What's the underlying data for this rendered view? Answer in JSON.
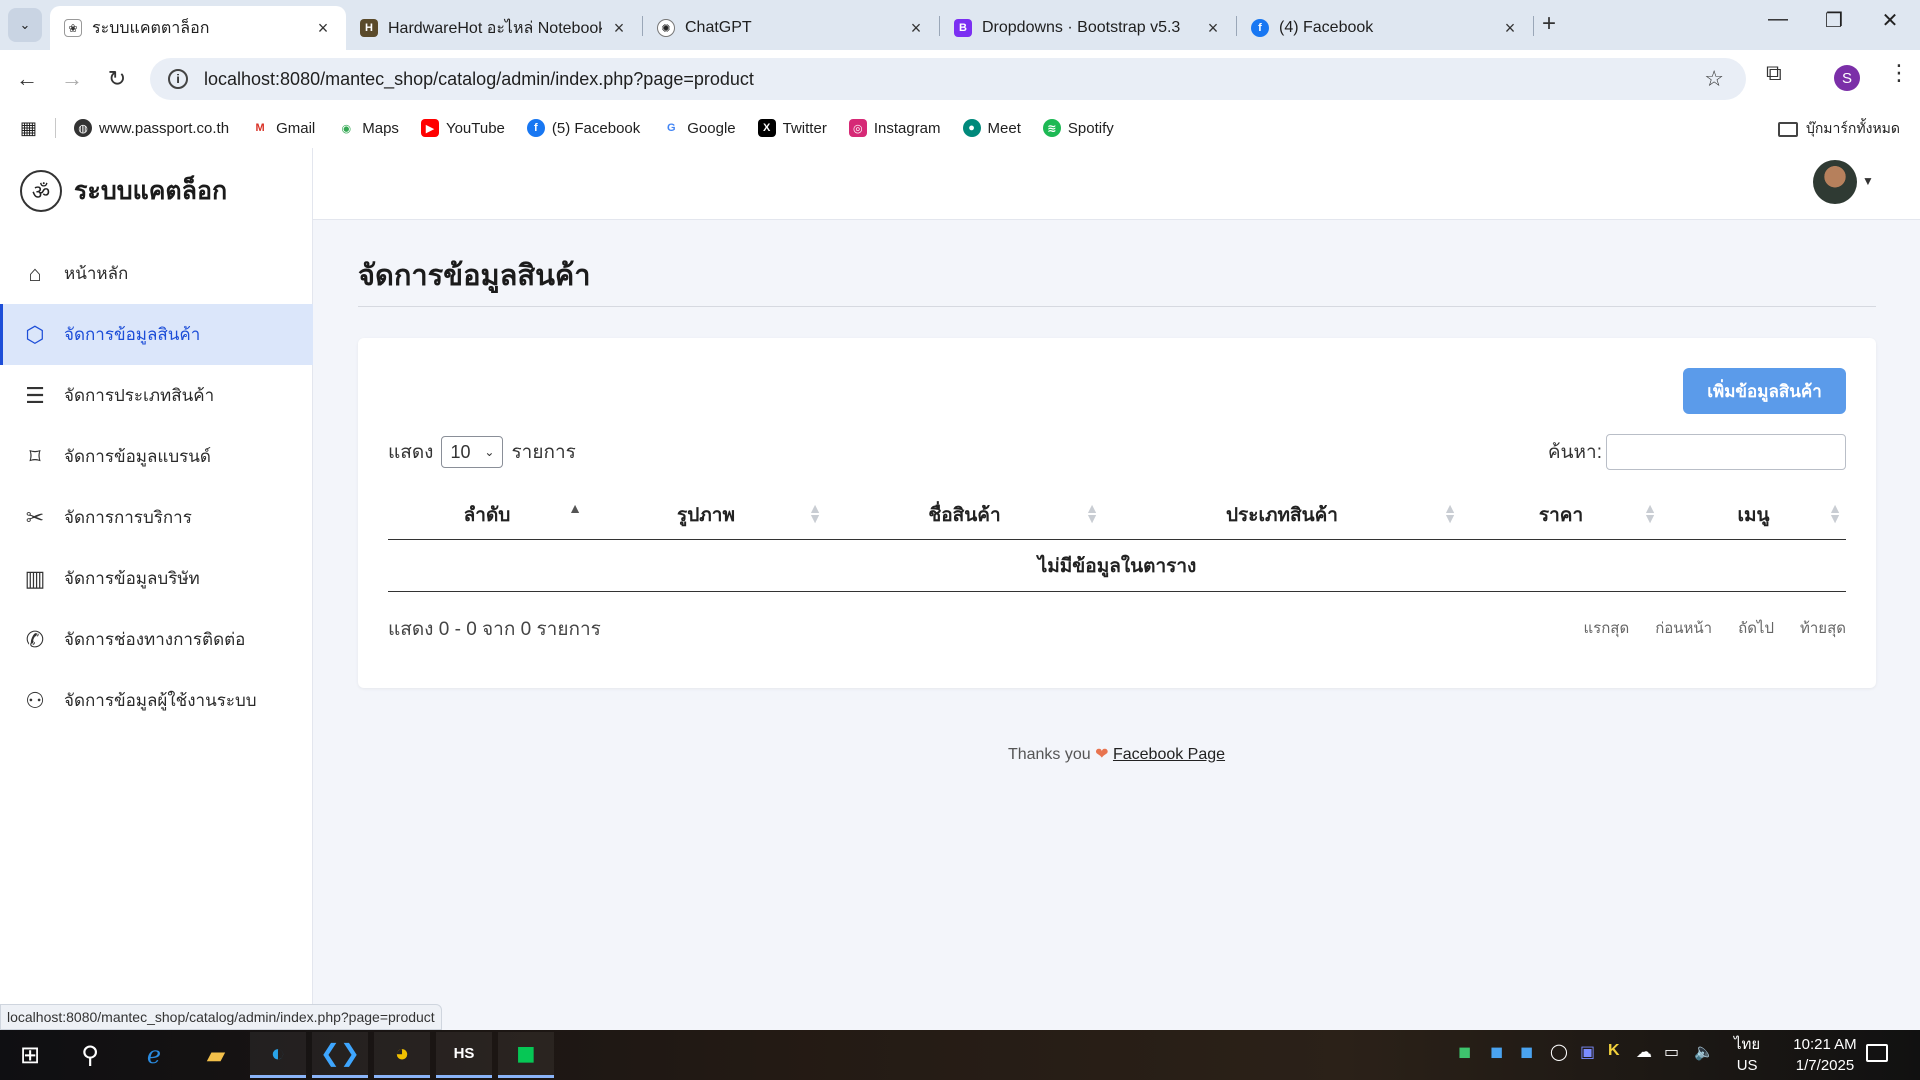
{
  "browser": {
    "tabs": [
      {
        "label": "ระบบแคตตาล็อก",
        "active": true
      },
      {
        "label": "HardwareHot อะไหล่ Notebook",
        "active": false
      },
      {
        "label": "ChatGPT",
        "active": false
      },
      {
        "label": "Dropdowns · Bootstrap v5.3",
        "active": false
      },
      {
        "label": "(4) Facebook",
        "active": false
      }
    ],
    "address": "localhost:8080/mantec_shop/catalog/admin/index.php?page=product",
    "profile_initial": "S",
    "bookmarks": [
      "www.passport.co.th",
      "Gmail",
      "Maps",
      "YouTube",
      "(5) Facebook",
      "Google",
      "Twitter",
      "Instagram",
      "Meet",
      "Spotify"
    ],
    "all_bookmarks": "บุ๊กมาร์กทั้งหมด"
  },
  "sidebar": {
    "brand": "ระบบแคตล็อก",
    "items": [
      {
        "label": "หน้าหลัก",
        "icon": "home-icon"
      },
      {
        "label": "จัดการข้อมูลสินค้า",
        "icon": "box-icon",
        "active": true
      },
      {
        "label": "จัดการประเภทสินค้า",
        "icon": "list-icon"
      },
      {
        "label": "จัดการข้อมูลแบรนด์",
        "icon": "tag-icon"
      },
      {
        "label": "จัดการการบริการ",
        "icon": "tools-icon"
      },
      {
        "label": "จัดการข้อมูลบริษัท",
        "icon": "building-icon"
      },
      {
        "label": "จัดการช่องทางการติดต่อ",
        "icon": "phone-icon"
      },
      {
        "label": "จัดการข้อมูลผู้ใช้งานระบบ",
        "icon": "users-icon"
      }
    ]
  },
  "main": {
    "title": "จัดการข้อมูลสินค้า",
    "add_button": "เพิ่มข้อมูลสินค้า",
    "show_label": "แสดง",
    "page_length": "10",
    "entries_label": "รายการ",
    "search_label": "ค้นหา:",
    "columns": [
      "ลำดับ",
      "รูปภาพ",
      "ชื่อสินค้า",
      "ประเภทสินค้า",
      "ราคา",
      "เมนู"
    ],
    "empty_text": "ไม่มีข้อมูลในตาราง",
    "info": "แสดง 0 - 0 จาก 0 รายการ",
    "pagination": [
      "แรกสุด",
      "ก่อนหน้า",
      "ถัดไป",
      "ท้ายสุด"
    ]
  },
  "footer": {
    "thanks": "Thanks you",
    "link": "Facebook Page"
  },
  "statusbar": "localhost:8080/mantec_shop/catalog/admin/index.php?page=product",
  "taskbar": {
    "lang_top": "ไทย",
    "lang_bottom": "US",
    "time": "10:21 AM",
    "date": "1/7/2025"
  },
  "colors": {
    "accent": "#1d4ed8",
    "add_button": "#5b9bea",
    "active_nav_bg": "#dbe6fa"
  }
}
